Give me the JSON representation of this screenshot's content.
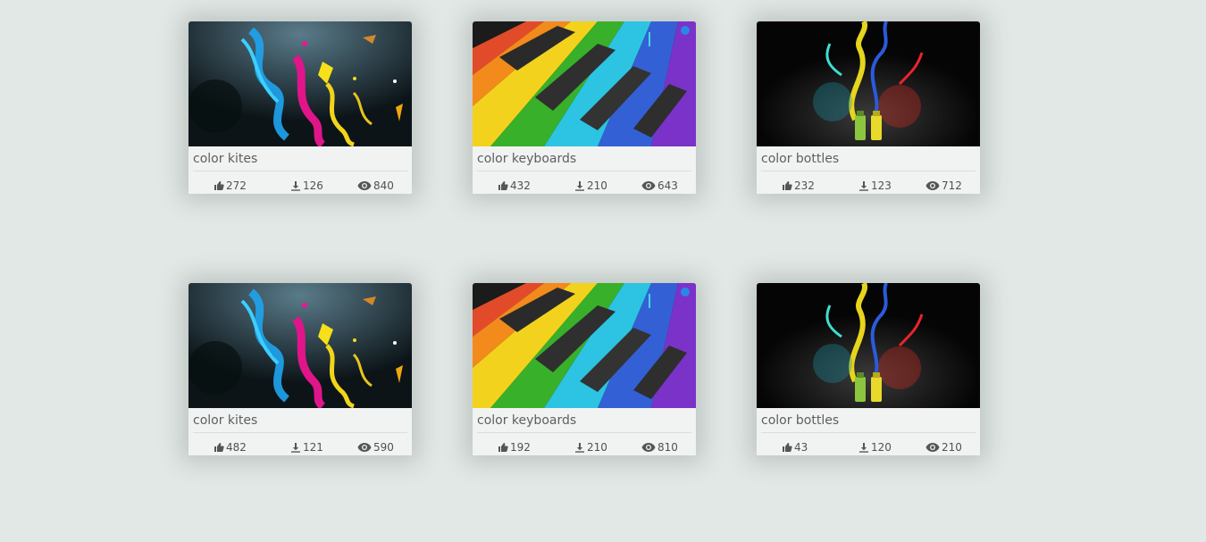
{
  "gallery": {
    "rows": [
      {
        "cards": [
          {
            "title": "color kites",
            "image": "colorful-paint-splash-kites-image",
            "likes": "272",
            "downloads": "126",
            "views": "840"
          },
          {
            "title": "color keyboards",
            "image": "rainbow-piano-keyboard-image",
            "likes": "432",
            "downloads": "210",
            "views": "643"
          },
          {
            "title": "color bottles",
            "image": "color-splash-bottles-image",
            "likes": "232",
            "downloads": "123",
            "views": "712"
          }
        ]
      },
      {
        "cards": [
          {
            "title": "color kites",
            "image": "colorful-paint-splash-kites-image",
            "likes": "482",
            "downloads": "121",
            "views": "590"
          },
          {
            "title": "color keyboards",
            "image": "rainbow-piano-keyboard-image",
            "likes": "192",
            "downloads": "210",
            "views": "810"
          },
          {
            "title": "color bottles",
            "image": "color-splash-bottles-image",
            "likes": "43",
            "downloads": "120",
            "views": "210"
          }
        ]
      }
    ],
    "icons": {
      "likes": "thumbs-up-icon",
      "downloads": "download-icon",
      "views": "eye-icon"
    },
    "colors": {
      "background": "#e2e8e6",
      "card": "#f1f3f2",
      "text": "#5e5e5e"
    }
  }
}
